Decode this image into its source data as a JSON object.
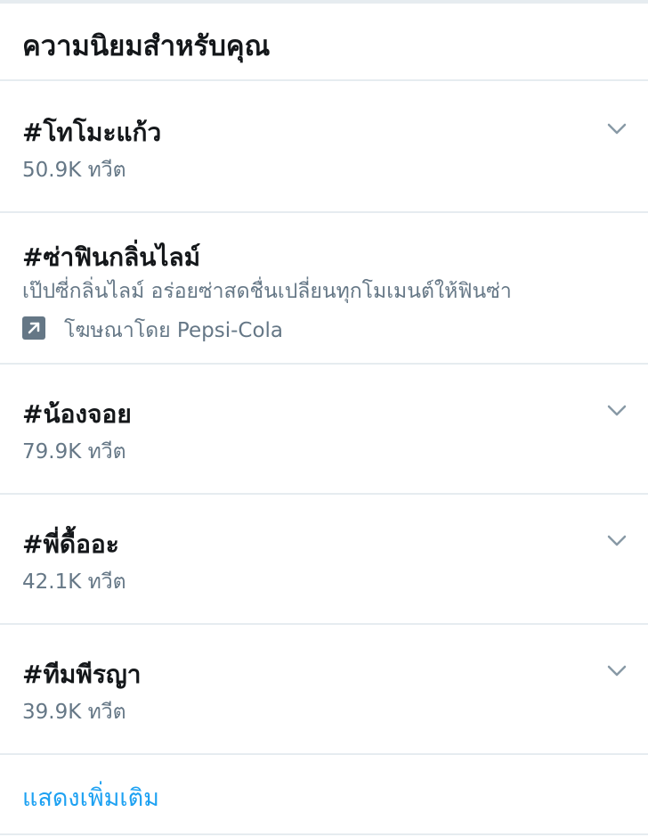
{
  "header": {
    "title": "ความนิยมสำหรับคุณ"
  },
  "trends": [
    {
      "name": "#โทโมะแก้ว",
      "meta": "50.9K ทวีต",
      "chevron_icon": "chevron-down-icon"
    },
    {
      "name": "#ซ่าฟินกลิ่นไลม์",
      "description": "เป๊ปซี่กลิ่นไลม์ อร่อยซ่าสดชื่นเปลี่ยนทุกโมเมนต์ให้ฟินซ่า",
      "promoted_text": "โฆษณาโดย Pepsi-Cola",
      "promoted_icon": "promoted-arrow-icon"
    },
    {
      "name": "#น้องจอย",
      "meta": "79.9K ทวีต",
      "chevron_icon": "chevron-down-icon"
    },
    {
      "name": "#พี่ดื้ออะ",
      "meta": "42.1K ทวีต",
      "chevron_icon": "chevron-down-icon"
    },
    {
      "name": "#ทีมพีรญา",
      "meta": "39.9K ทวีต",
      "chevron_icon": "chevron-down-icon"
    }
  ],
  "show_more": {
    "label": "แสดงเพิ่มเติม"
  },
  "colors": {
    "text_primary": "#14171a",
    "text_secondary": "#657786",
    "accent": "#1da1f2",
    "divider": "#e6ecf0",
    "chevron": "#8899a6"
  }
}
